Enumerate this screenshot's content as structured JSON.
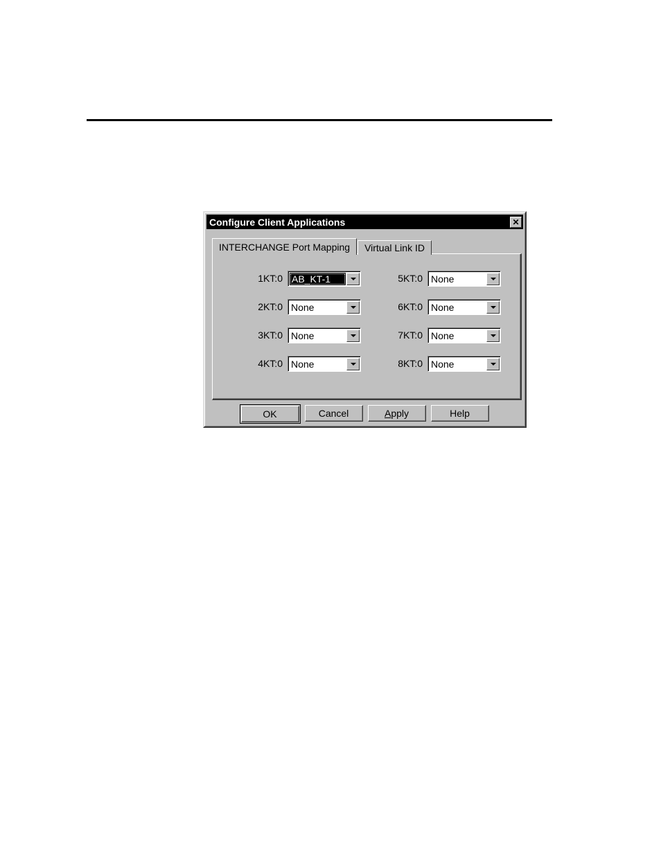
{
  "page": {
    "rule_present": true
  },
  "dialog": {
    "title": "Configure Client Applications",
    "close_label": "✕",
    "tabs": [
      {
        "label": "INTERCHANGE Port Mapping",
        "active": true
      },
      {
        "label": "Virtual Link ID",
        "active": false
      }
    ],
    "port_rows": [
      {
        "left": {
          "label": "1KT:0",
          "value": "AB_KT-1",
          "focused": true
        },
        "right": {
          "label": "5KT:0",
          "value": "None",
          "focused": false
        }
      },
      {
        "left": {
          "label": "2KT:0",
          "value": "None",
          "focused": false
        },
        "right": {
          "label": "6KT:0",
          "value": "None",
          "focused": false
        }
      },
      {
        "left": {
          "label": "3KT:0",
          "value": "None",
          "focused": false
        },
        "right": {
          "label": "7KT:0",
          "value": "None",
          "focused": false
        }
      },
      {
        "left": {
          "label": "4KT:0",
          "value": "None",
          "focused": false
        },
        "right": {
          "label": "8KT:0",
          "value": "None",
          "focused": false
        }
      }
    ],
    "buttons": [
      {
        "label": "OK",
        "default": true,
        "mnemonic": ""
      },
      {
        "label": "Cancel",
        "default": false,
        "mnemonic": ""
      },
      {
        "label": "Apply",
        "default": false,
        "mnemonic": "A"
      },
      {
        "label": "Help",
        "default": false,
        "mnemonic": ""
      }
    ],
    "colors": {
      "face": "#c0c0c0",
      "titlebar": "#000000",
      "titlebar_text": "#ffffff",
      "field": "#ffffff",
      "highlight": "#000000"
    }
  }
}
